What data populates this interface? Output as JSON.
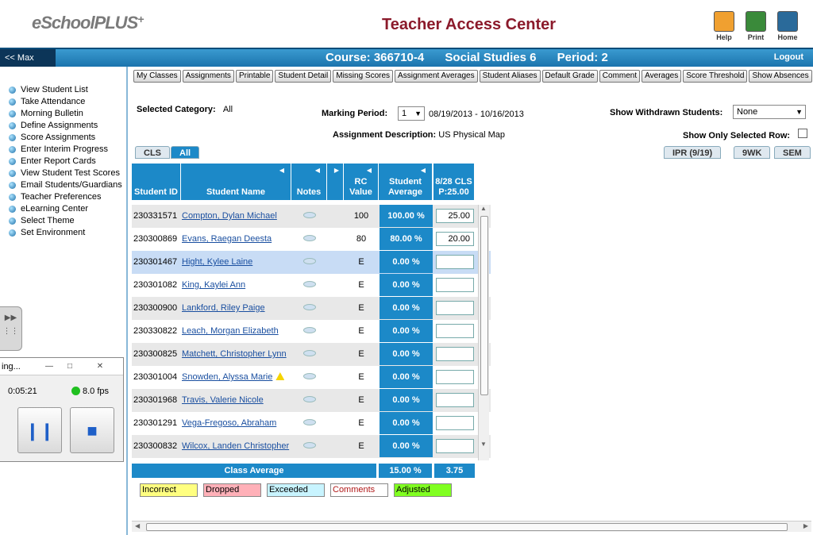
{
  "header": {
    "logo_text": "eSchoolPLUS",
    "logo_plus": "+",
    "title": "Teacher Access Center",
    "buttons": {
      "help": "Help",
      "print": "Print",
      "home": "Home"
    }
  },
  "course_bar": {
    "max_label": "<< Max",
    "course": "Course: 366710-4",
    "name": "Social Studies 6",
    "period": "Period: 2",
    "logout": "Logout"
  },
  "sidebar": {
    "items": [
      "View Student List",
      "Take Attendance",
      "Morning Bulletin",
      "Define Assignments",
      "Score Assignments",
      "Enter Interim Progress",
      "Enter Report Cards",
      "View Student Test Scores",
      "Email Students/Guardians",
      "Teacher Preferences",
      "eLearning Center",
      "Select Theme",
      "Set Environment"
    ]
  },
  "recorder": {
    "title": "ing...",
    "time": "0:05:21",
    "fps": "8.0 fps"
  },
  "toolbar": {
    "buttons": [
      "My Classes",
      "Assignments",
      "Printable",
      "Student Detail",
      "Missing Scores",
      "Assignment Averages",
      "Student Aliases",
      "Default Grade",
      "Comment",
      "Averages",
      "Score Threshold",
      "Show Absences"
    ]
  },
  "filters": {
    "selected_category_label": "Selected Category:",
    "selected_category_value": "All",
    "marking_period_label": "Marking Period:",
    "marking_period_value": "1",
    "marking_period_dates": "08/19/2013 - 10/16/2013",
    "show_withdrawn_label": "Show Withdrawn Students:",
    "show_withdrawn_value": "None",
    "assignment_desc_label": "Assignment Description:",
    "assignment_desc_value": "US Physical Map",
    "show_selected_label": "Show Only Selected Row:"
  },
  "tabs": {
    "left": [
      "CLS",
      "All"
    ],
    "right": [
      "IPR (9/19)",
      "9WK",
      "SEM"
    ]
  },
  "grid": {
    "headers": {
      "student_id": "Student ID",
      "student_name": "Student Name",
      "notes": "Notes",
      "rc_value": "RC Value",
      "student_average": "Student Average",
      "assignment": "8/28 CLS P:25.00"
    },
    "rows": [
      {
        "id": "230331571",
        "name": "Compton, Dylan Michael",
        "rc": "100",
        "avg": "100.00 %",
        "score": "25.00"
      },
      {
        "id": "230300869",
        "name": "Evans, Raegan Deesta",
        "rc": "80",
        "avg": "80.00 %",
        "score": "20.00"
      },
      {
        "id": "230301467",
        "name": "Hight, Kylee Laine",
        "rc": "E",
        "avg": "0.00 %",
        "score": ""
      },
      {
        "id": "230301082",
        "name": "King, Kaylei Ann",
        "rc": "E",
        "avg": "0.00 %",
        "score": ""
      },
      {
        "id": "230300900",
        "name": "Lankford, Riley Paige",
        "rc": "E",
        "avg": "0.00 %",
        "score": ""
      },
      {
        "id": "230330822",
        "name": "Leach, Morgan Elizabeth",
        "rc": "E",
        "avg": "0.00 %",
        "score": ""
      },
      {
        "id": "230300825",
        "name": "Matchett, Christopher Lynn",
        "rc": "E",
        "avg": "0.00 %",
        "score": ""
      },
      {
        "id": "230301004",
        "name": "Snowden, Alyssa Marie",
        "rc": "E",
        "avg": "0.00 %",
        "score": ""
      },
      {
        "id": "230301968",
        "name": "Travis, Valerie Nicole",
        "rc": "E",
        "avg": "0.00 %",
        "score": ""
      },
      {
        "id": "230301291",
        "name": "Vega-Fregoso, Abraham",
        "rc": "E",
        "avg": "0.00 %",
        "score": ""
      },
      {
        "id": "230300832",
        "name": "Wilcox, Landen Christopher",
        "rc": "E",
        "avg": "0.00 %",
        "score": ""
      }
    ],
    "class_average_label": "Class Average",
    "class_average_value": "15.00 %",
    "class_average_score": "3.75"
  },
  "legend": {
    "incorrect": "Incorrect",
    "dropped": "Dropped",
    "exceeded": "Exceeded",
    "comments": "Comments",
    "adjusted": "Adjusted"
  },
  "colors": {
    "accent": "#1c89c8",
    "title": "#8b1a2b",
    "incorrect": "#ffff80",
    "dropped": "#ffb0b8",
    "exceeded": "#c8f4ff",
    "adjusted": "#80ff20"
  }
}
